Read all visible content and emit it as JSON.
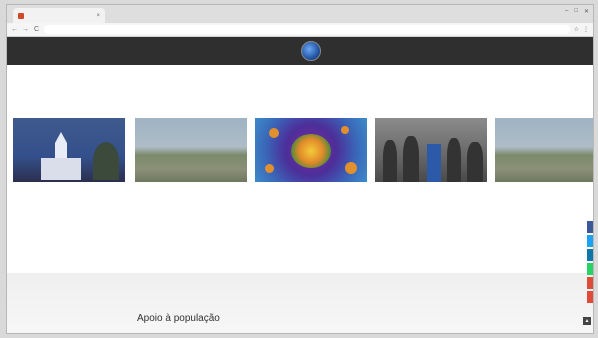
{
  "browser": {
    "tab_title": "",
    "url": "",
    "back": "←",
    "forward": "→",
    "reload": "C",
    "minimize": "–",
    "maximize": "□",
    "close": "✕"
  },
  "site_nav": {
    "left_menu": [
      "",
      "",
      ""
    ],
    "right_menu": [
      "",
      "",
      ""
    ]
  },
  "section_label": "",
  "cards": [
    {
      "category": "",
      "title": "",
      "date": ""
    },
    {
      "category": "",
      "title": "",
      "date": ""
    },
    {
      "category": "",
      "title": "",
      "date": ""
    },
    {
      "category": "",
      "title": "",
      "date": ""
    },
    {
      "category": "",
      "title": "",
      "date": ""
    }
  ],
  "footer_section": {
    "kicker": "",
    "heading": "Apoio à população",
    "text_lines": [
      "",
      ""
    ]
  },
  "share_colors": [
    "#3b5998",
    "#1da1f2",
    "#0e76a8",
    "#25d366",
    "#dd4b39",
    "#e04a3a"
  ],
  "accent_color": "#39a845",
  "back_to_top_icon": "chevron-up-icon"
}
